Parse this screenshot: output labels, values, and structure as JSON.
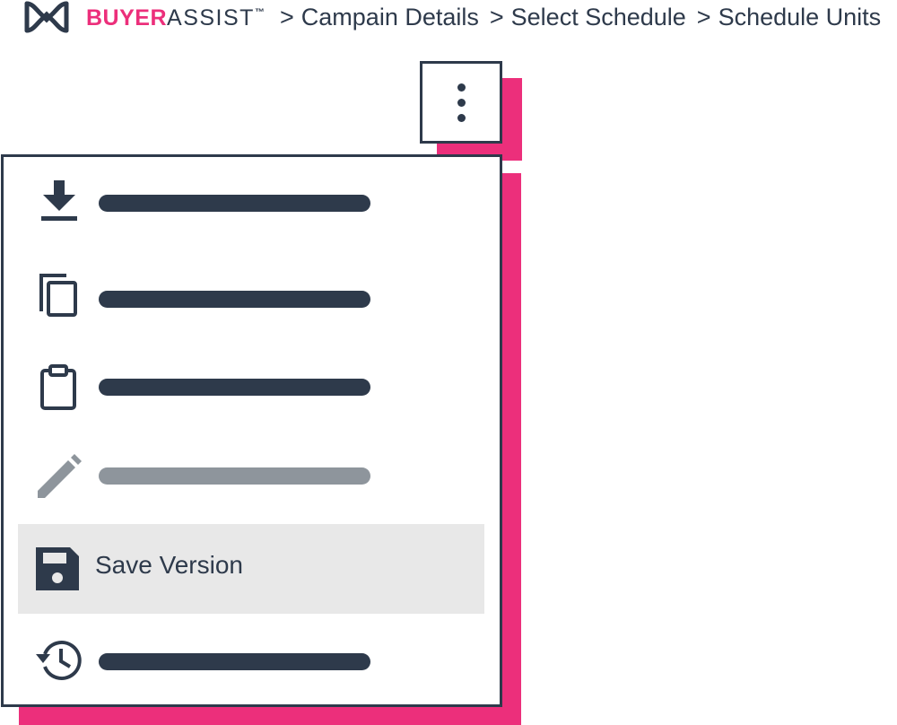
{
  "brand": {
    "buyer": "BUYER",
    "assist": "ASSIST",
    "tm": "™",
    "accent_color": "#ec2f7b",
    "text_color": "#2e3a4b"
  },
  "breadcrumb": {
    "separator": ">",
    "items": [
      "Campain Details",
      "Select Schedule",
      "Schedule Units"
    ]
  },
  "menu_trigger": {
    "icon": "kebab-vertical-icon"
  },
  "menu": {
    "shadow_color": "#ec2f7b",
    "items": [
      {
        "icon": "download-icon",
        "label": "",
        "state": "enabled"
      },
      {
        "icon": "copy-icon",
        "label": "",
        "state": "enabled"
      },
      {
        "icon": "clipboard-icon",
        "label": "",
        "state": "enabled"
      },
      {
        "icon": "pencil-icon",
        "label": "",
        "state": "disabled"
      },
      {
        "icon": "floppy-disk-icon",
        "label": "Save Version",
        "state": "highlighted"
      },
      {
        "icon": "history-icon",
        "label": "",
        "state": "enabled"
      }
    ]
  }
}
